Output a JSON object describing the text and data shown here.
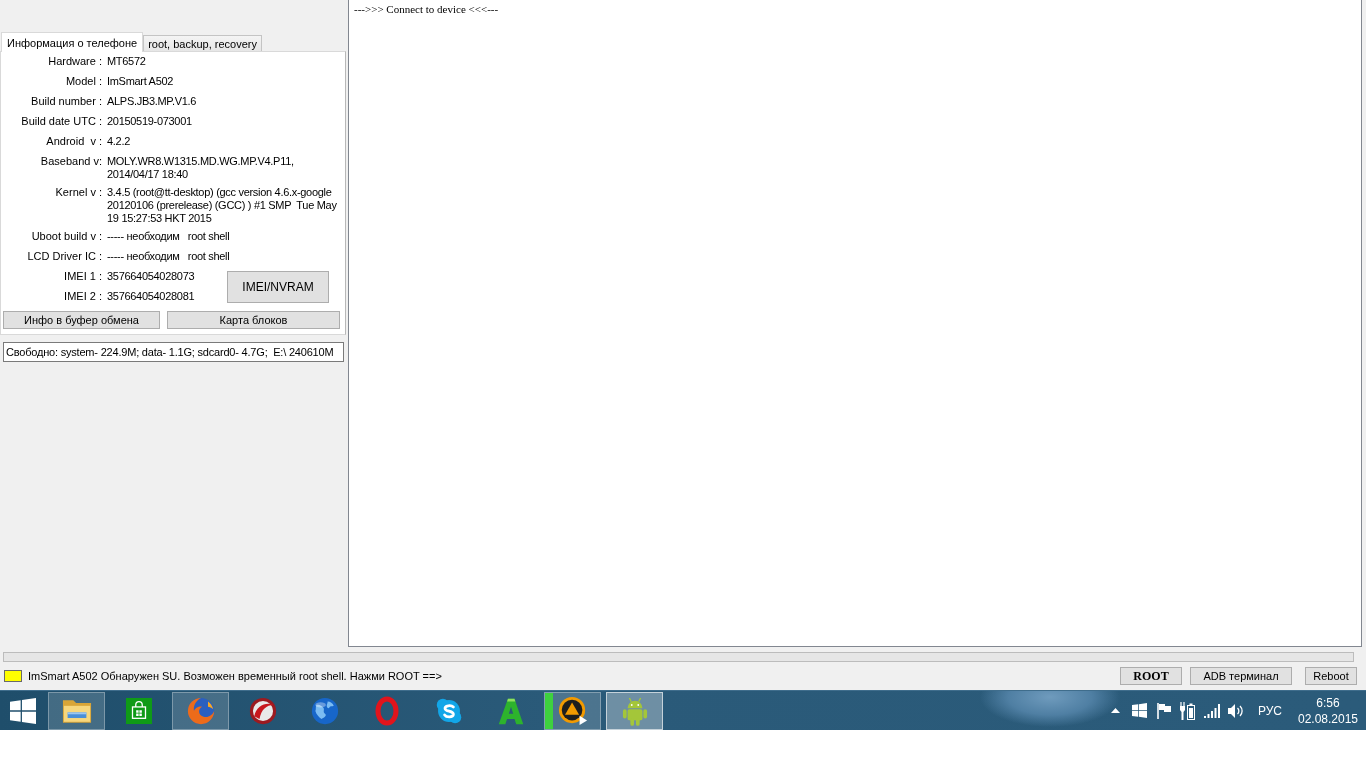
{
  "tabs": [
    {
      "label": "Информация о телефоне",
      "selected": true
    },
    {
      "label": "root, backup, recovery",
      "selected": false
    }
  ],
  "phone_info": {
    "rows": [
      {
        "label": "Hardware :",
        "value": "MT6572"
      },
      {
        "label": "Model :",
        "value": "ImSmart A502"
      },
      {
        "label": "Build number :",
        "value": "ALPS.JB3.MP.V1.6"
      },
      {
        "label": "Build date UTC :",
        "value": "20150519-073001"
      },
      {
        "label": "Android  v :",
        "value": "4.2.2"
      },
      {
        "label": "Baseband v:",
        "value": "MOLY.WR8.W1315.MD.WG.MP.V4.P11, 2014/04/17 18:40"
      },
      {
        "label": "Kernel v :",
        "value": "3.4.5 (root@tt-desktop) (gcc version 4.6.x-google 20120106 (prerelease) (GCC) ) #1 SMP  Tue May 19 15:27:53 HKT 2015"
      },
      {
        "label": "Uboot build v :",
        "value": "----- необходим   root shell"
      },
      {
        "label": "LCD Driver IC :",
        "value": "----- необходим   root shell"
      }
    ],
    "imei_rows": [
      {
        "label": "IMEI 1 :",
        "value": "357664054028073"
      },
      {
        "label": "IMEI 2 :",
        "value": "357664054028081"
      }
    ],
    "imei_button": "IMEI/NVRAM",
    "buttons": [
      "Инфо в буфер обмена",
      "Карта блоков"
    ]
  },
  "free_space": "Свободно: system- 224.9M; data- 1.1G; sdcard0- 4.7G;  E:\\ 240610M",
  "console": {
    "lines": [
      "--->>> Connect to device <<<---"
    ]
  },
  "progress": {
    "level": 0
  },
  "status": {
    "color": "#ffff00",
    "text": "ImSmart A502 Обнаружен SU. Возможен временный root shell. Нажми ROOT ==>"
  },
  "actions": [
    {
      "label": "ROOT",
      "kind": "bold"
    },
    {
      "label": "ADB терминал",
      "kind": "plain"
    },
    {
      "label": "Reboot",
      "kind": "plain"
    }
  ],
  "taskbar": {
    "apps": [
      {
        "running": true,
        "selected": false
      },
      {
        "running": false,
        "selected": false
      },
      {
        "running": true,
        "selected": false
      },
      {
        "running": false,
        "selected": false
      },
      {
        "running": false,
        "selected": false
      },
      {
        "running": false,
        "selected": false
      },
      {
        "running": false,
        "selected": false
      },
      {
        "running": false,
        "selected": false
      },
      {
        "running": true,
        "selected": false,
        "level": 0.14
      },
      {
        "running": true,
        "selected": true
      }
    ],
    "tray": {
      "language": "РУС",
      "time": "6:56",
      "date": "02.08.2015"
    }
  }
}
